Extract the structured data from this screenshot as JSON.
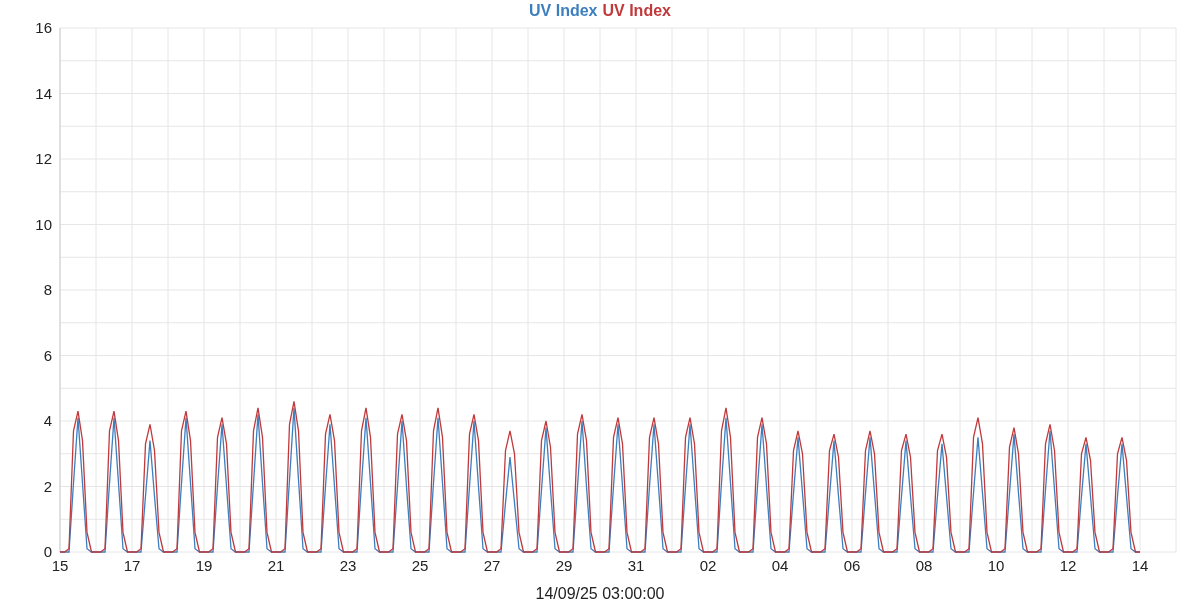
{
  "chart": {
    "chart_data": {
      "type": "line",
      "xlabel": "14/09/25 03:00:00",
      "grid": true,
      "series": [
        {
          "name": "UV Index",
          "color": "#3d7ebf",
          "values": [
            0,
            0,
            0,
            2.1,
            4.1,
            2.1,
            0.1,
            0,
            0,
            0,
            0,
            2.1,
            4.1,
            2.1,
            0.1,
            0,
            0,
            0,
            0,
            1.7,
            3.4,
            1.7,
            0.1,
            0,
            0,
            0,
            0,
            2.1,
            4.1,
            2.1,
            0.1,
            0,
            0,
            0,
            0,
            2.0,
            3.9,
            2.0,
            0.1,
            0,
            0,
            0,
            0,
            2.1,
            4.2,
            2.1,
            0.1,
            0,
            0,
            0,
            0,
            2.2,
            4.4,
            2.2,
            0.1,
            0,
            0,
            0,
            0,
            2.0,
            3.9,
            2.0,
            0.1,
            0,
            0,
            0,
            0,
            2.1,
            4.1,
            2.1,
            0.1,
            0,
            0,
            0,
            0,
            2.0,
            4.0,
            2.0,
            0.1,
            0,
            0,
            0,
            0,
            2.1,
            4.1,
            2.1,
            0.1,
            0,
            0,
            0,
            0,
            2.0,
            4.0,
            2.0,
            0.1,
            0,
            0,
            0,
            0,
            1.5,
            2.9,
            1.5,
            0.1,
            0,
            0,
            0,
            0,
            1.9,
            3.8,
            1.9,
            0.1,
            0,
            0,
            0,
            0,
            2.0,
            4.0,
            2.0,
            0.1,
            0,
            0,
            0,
            0,
            2.0,
            3.9,
            2.0,
            0.1,
            0,
            0,
            0,
            0,
            2.0,
            3.9,
            2.0,
            0.1,
            0,
            0,
            0,
            0,
            2.0,
            3.9,
            2.0,
            0.1,
            0,
            0,
            0,
            0,
            2.1,
            4.1,
            2.1,
            0.1,
            0,
            0,
            0,
            0,
            2.0,
            3.9,
            2.0,
            0.1,
            0,
            0,
            0,
            0,
            1.8,
            3.5,
            1.8,
            0.1,
            0,
            0,
            0,
            0,
            1.7,
            3.4,
            1.7,
            0.1,
            0,
            0,
            0,
            0,
            1.8,
            3.5,
            1.8,
            0.1,
            0,
            0,
            0,
            0,
            1.7,
            3.4,
            1.7,
            0.1,
            0,
            0,
            0,
            0,
            1.7,
            3.3,
            1.7,
            0.1,
            0,
            0,
            0,
            0,
            1.8,
            3.5,
            1.8,
            0.1,
            0,
            0,
            0,
            0,
            1.8,
            3.6,
            1.8,
            0.1,
            0,
            0,
            0,
            0,
            1.9,
            3.7,
            1.9,
            0.1,
            0,
            0,
            0,
            0,
            1.7,
            3.3,
            1.7,
            0.1,
            0,
            0,
            0,
            0,
            1.7,
            3.3,
            1.7,
            0.1,
            0,
            0
          ]
        },
        {
          "name": "UV Index",
          "color": "#c0393b",
          "values": [
            0,
            0,
            0.1,
            3.7,
            4.3,
            3.4,
            0.6,
            0,
            0,
            0,
            0.1,
            3.7,
            4.3,
            3.4,
            0.6,
            0,
            0,
            0,
            0.1,
            3.3,
            3.9,
            3.1,
            0.6,
            0,
            0,
            0,
            0.1,
            3.7,
            4.3,
            3.4,
            0.6,
            0,
            0,
            0,
            0.1,
            3.5,
            4.1,
            3.3,
            0.6,
            0,
            0,
            0,
            0.1,
            3.7,
            4.4,
            3.5,
            0.6,
            0,
            0,
            0,
            0.1,
            3.9,
            4.6,
            3.7,
            0.6,
            0,
            0,
            0,
            0.1,
            3.6,
            4.2,
            3.4,
            0.6,
            0,
            0,
            0,
            0.1,
            3.7,
            4.4,
            3.5,
            0.6,
            0,
            0,
            0,
            0.1,
            3.6,
            4.2,
            3.4,
            0.6,
            0,
            0,
            0,
            0.1,
            3.7,
            4.4,
            3.5,
            0.6,
            0,
            0,
            0,
            0.1,
            3.6,
            4.2,
            3.4,
            0.6,
            0,
            0,
            0,
            0.1,
            3.1,
            3.7,
            3.0,
            0.6,
            0,
            0,
            0,
            0.1,
            3.4,
            4.0,
            3.2,
            0.6,
            0,
            0,
            0,
            0.1,
            3.6,
            4.2,
            3.4,
            0.6,
            0,
            0,
            0,
            0.1,
            3.5,
            4.1,
            3.3,
            0.6,
            0,
            0,
            0,
            0.1,
            3.5,
            4.1,
            3.3,
            0.6,
            0,
            0,
            0,
            0.1,
            3.5,
            4.1,
            3.3,
            0.6,
            0,
            0,
            0,
            0.1,
            3.7,
            4.4,
            3.5,
            0.6,
            0,
            0,
            0,
            0.1,
            3.5,
            4.1,
            3.3,
            0.6,
            0,
            0,
            0,
            0.1,
            3.1,
            3.7,
            3.0,
            0.6,
            0,
            0,
            0,
            0.1,
            3.1,
            3.6,
            2.9,
            0.6,
            0,
            0,
            0,
            0.1,
            3.1,
            3.7,
            3.0,
            0.6,
            0,
            0,
            0,
            0.1,
            3.1,
            3.6,
            2.9,
            0.6,
            0,
            0,
            0,
            0.1,
            3.1,
            3.6,
            2.9,
            0.6,
            0,
            0,
            0,
            0.1,
            3.5,
            4.1,
            3.3,
            0.6,
            0,
            0,
            0,
            0.1,
            3.2,
            3.8,
            3.0,
            0.6,
            0,
            0,
            0,
            0.1,
            3.3,
            3.9,
            3.1,
            0.6,
            0,
            0,
            0,
            0.1,
            3.0,
            3.5,
            2.8,
            0.6,
            0,
            0,
            0,
            0.1,
            3.0,
            3.5,
            2.8,
            0.6,
            0,
            0
          ]
        }
      ],
      "ylim": [
        0,
        16
      ],
      "categories": [
        "15",
        null,
        null,
        null,
        null,
        null,
        null,
        null,
        null,
        null,
        null,
        null,
        null,
        null,
        null,
        null,
        "17",
        null,
        null,
        null,
        null,
        null,
        null,
        null,
        null,
        null,
        null,
        null,
        null,
        null,
        null,
        null,
        "19",
        null,
        null,
        null,
        null,
        null,
        null,
        null,
        null,
        null,
        null,
        null,
        null,
        null,
        null,
        null,
        "21",
        null,
        null,
        null,
        null,
        null,
        null,
        null,
        null,
        null,
        null,
        null,
        null,
        null,
        null,
        null,
        "23",
        null,
        null,
        null,
        null,
        null,
        null,
        null,
        null,
        null,
        null,
        null,
        null,
        null,
        null,
        null,
        "25",
        null,
        null,
        null,
        null,
        null,
        null,
        null,
        null,
        null,
        null,
        null,
        null,
        null,
        null,
        null,
        "27",
        null,
        null,
        null,
        null,
        null,
        null,
        null,
        null,
        null,
        null,
        null,
        null,
        null,
        null,
        null,
        "29",
        null,
        null,
        null,
        null,
        null,
        null,
        null,
        null,
        null,
        null,
        null,
        null,
        null,
        null,
        null,
        "31",
        null,
        null,
        null,
        null,
        null,
        null,
        null,
        null,
        null,
        null,
        null,
        null,
        null,
        null,
        null,
        "02",
        null,
        null,
        null,
        null,
        null,
        null,
        null,
        null,
        null,
        null,
        null,
        null,
        null,
        null,
        null,
        "04",
        null,
        null,
        null,
        null,
        null,
        null,
        null,
        null,
        null,
        null,
        null,
        null,
        null,
        null,
        null,
        "06",
        null,
        null,
        null,
        null,
        null,
        null,
        null,
        null,
        null,
        null,
        null,
        null,
        null,
        null,
        null,
        "08",
        null,
        null,
        null,
        null,
        null,
        null,
        null,
        null,
        null,
        null,
        null,
        null,
        null,
        null,
        null,
        "10",
        null,
        null,
        null,
        null,
        null,
        null,
        null,
        null,
        null,
        null,
        null,
        null,
        null,
        null,
        null,
        "12",
        null,
        null,
        null,
        null,
        null,
        null,
        null,
        null,
        null,
        null,
        null,
        null,
        null,
        null,
        null,
        "14"
      ],
      "yticks": [
        0,
        2,
        4,
        6,
        8,
        10,
        12,
        14,
        16
      ]
    }
  }
}
